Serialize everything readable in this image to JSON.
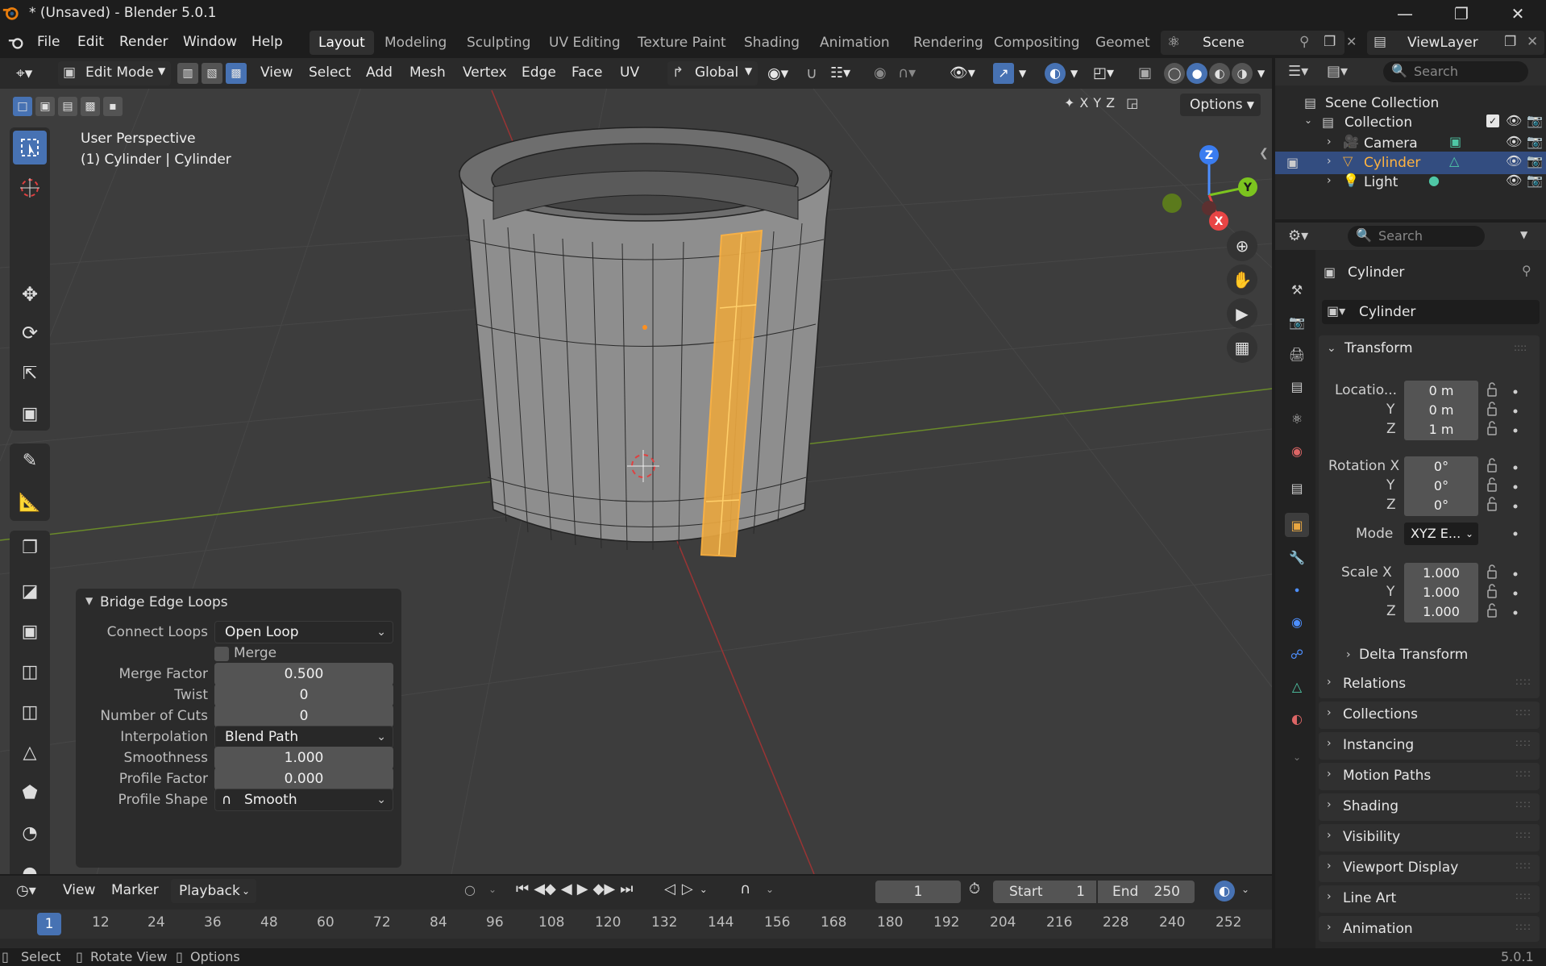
{
  "window": {
    "title": "* (Unsaved) - Blender 5.0.1"
  },
  "menubar": {
    "items": [
      "File",
      "Edit",
      "Render",
      "Window",
      "Help"
    ],
    "workspaces": [
      "Layout",
      "Modeling",
      "Sculpting",
      "UV Editing",
      "Texture Paint",
      "Shading",
      "Animation",
      "Rendering",
      "Compositing",
      "Geometr"
    ],
    "scene": "Scene",
    "view_layer": "ViewLayer"
  },
  "viewport_header": {
    "mode": "Edit Mode",
    "menus": [
      "View",
      "Select",
      "Add",
      "Mesh",
      "Vertex",
      "Edge",
      "Face",
      "UV"
    ],
    "orientation": "Global",
    "options": "Options",
    "axes": [
      "X",
      "Y",
      "Z"
    ]
  },
  "viewport": {
    "perspective": "User Perspective",
    "object_info": "(1) Cylinder | Cylinder",
    "gizmo": {
      "x": "X",
      "y": "Y",
      "z": "Z"
    }
  },
  "operator_panel": {
    "title": "Bridge Edge Loops",
    "connect_loops_label": "Connect Loops",
    "connect_loops_value": "Open Loop",
    "merge_label": "Merge",
    "merge_factor_label": "Merge Factor",
    "merge_factor_value": "0.500",
    "twist_label": "Twist",
    "twist_value": "0",
    "cuts_label": "Number of Cuts",
    "cuts_value": "0",
    "interpolation_label": "Interpolation",
    "interpolation_value": "Blend Path",
    "smoothness_label": "Smoothness",
    "smoothness_value": "1.000",
    "profile_factor_label": "Profile Factor",
    "profile_factor_value": "0.000",
    "profile_shape_label": "Profile Shape",
    "profile_shape_value": "Smooth"
  },
  "outliner": {
    "search_placeholder": "Search",
    "scene_collection": "Scene Collection",
    "collection": "Collection",
    "items": [
      {
        "name": "Camera"
      },
      {
        "name": "Cylinder"
      },
      {
        "name": "Light"
      }
    ]
  },
  "properties": {
    "search_placeholder": "Search",
    "object_name": "Cylinder",
    "data_name": "Cylinder",
    "transform_title": "Transform",
    "location_label": "Locatio...",
    "location": [
      "0 m",
      "0 m",
      "1 m"
    ],
    "rotation_label": "Rotation X",
    "rotation": [
      "0°",
      "0°",
      "0°"
    ],
    "mode_label": "Mode",
    "mode_value": "XYZ E...",
    "scale_label": "Scale X",
    "scale": [
      "1.000",
      "1.000",
      "1.000"
    ],
    "y_label": "Y",
    "z_label": "Z",
    "delta_transform": "Delta Transform",
    "sections": [
      "Relations",
      "Collections",
      "Instancing",
      "Motion Paths",
      "Shading",
      "Visibility",
      "Viewport Display",
      "Line Art",
      "Animation"
    ]
  },
  "timeline": {
    "menus": [
      "View",
      "Marker",
      "Playback"
    ],
    "current_frame": "1",
    "start_label": "Start",
    "start_value": "1",
    "end_label": "End",
    "end_value": "250",
    "ticks": [
      "1",
      "12",
      "24",
      "36",
      "48",
      "60",
      "72",
      "84",
      "96",
      "108",
      "120",
      "132",
      "144",
      "156",
      "168",
      "180",
      "192",
      "204",
      "216",
      "228",
      "240",
      "252"
    ]
  },
  "statusbar": {
    "select": "Select",
    "rotate": "Rotate View",
    "options": "Options",
    "version": "5.0.1"
  },
  "colors": {
    "accent": "#4772b3",
    "selection": "#f5a623",
    "background": "#3d3d3d"
  }
}
